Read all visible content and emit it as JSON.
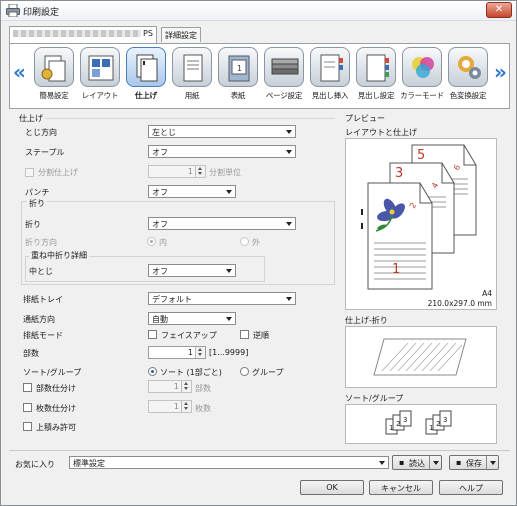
{
  "window": {
    "title": "印刷設定",
    "close_glyph": "✕"
  },
  "tabs": {
    "printer_tab_suffix": "PS",
    "detail_tab": "詳細設定"
  },
  "iconbar": {
    "prev_glyph": "«",
    "next_glyph": "»",
    "items": [
      {
        "label": "簡易設定",
        "icon": "quick-setup-icon"
      },
      {
        "label": "レイアウト",
        "icon": "layout-icon"
      },
      {
        "label": "仕上げ",
        "icon": "finishing-icon"
      },
      {
        "label": "用紙",
        "icon": "paper-icon"
      },
      {
        "label": "表紙",
        "icon": "cover-icon"
      },
      {
        "label": "ページ設定",
        "icon": "page-setup-icon"
      },
      {
        "label": "見出し挿入",
        "icon": "tab-insert-icon"
      },
      {
        "label": "見出し設定",
        "icon": "tab-setting-icon"
      },
      {
        "label": "カラーモード",
        "icon": "color-mode-icon"
      },
      {
        "label": "色変換設定",
        "icon": "color-conversion-icon"
      }
    ],
    "active": "仕上げ"
  },
  "finishing": {
    "section_title": "仕上げ",
    "binding_label": "とじ方向",
    "binding_value": "左とじ",
    "staple_label": "ステープル",
    "staple_value": "オフ",
    "split_finish_label": "分割仕上げ",
    "split_value": "1",
    "split_unit": "分割単位",
    "punch_label": "パンチ",
    "punch_value": "オフ",
    "fold_group_title": "折り",
    "fold_label": "折り",
    "fold_value": "オフ",
    "fold_dir_label": "折り方向",
    "fold_dir_in": "内",
    "fold_dir_out": "外",
    "saddle_group_title": "重ね中折り詳細",
    "saddle_label": "中とじ",
    "saddle_value": "オフ"
  },
  "output": {
    "tray_label": "排紙トレイ",
    "tray_value": "デフォルト",
    "feed_dir_label": "通紙方向",
    "feed_dir_value": "自動",
    "eject_mode_label": "排紙モード",
    "face_up_label": "フェイスアップ",
    "reverse_label": "逆順",
    "copies_label": "部数",
    "copies_value": "1",
    "copies_range": "[1...9999]",
    "sort_group_label": "ソート/グループ",
    "sort_label": "ソート (1部ごと)",
    "group_label": "グループ",
    "set_split_label": "部数仕分け",
    "set_split_value": "1",
    "set_split_unit": "部数",
    "sheet_split_label": "枚数仕分け",
    "sheet_split_value": "1",
    "sheet_split_unit": "枚数",
    "stack_label": "上積み許可"
  },
  "preview": {
    "title": "プレビュー",
    "layout_title": "レイアウトと仕上げ",
    "paper_size": "A4",
    "paper_dims": "210.0x297.0 mm",
    "page_numbers": [
      "5",
      "6",
      "3",
      "4",
      "1",
      "2"
    ],
    "fold_title": "仕上げ-折り",
    "sort_title": "ソート/グループ",
    "sort_digits": [
      "1",
      "2",
      "3",
      "1",
      "2",
      "3"
    ]
  },
  "bottom": {
    "favorites_label": "お気に入り",
    "favorites_value": "標準設定",
    "load_label": "読込",
    "save_label": "保存",
    "ok_label": "OK",
    "cancel_label": "キャンセル",
    "help_label": "ヘルプ"
  },
  "colors": {
    "accent": "#2d78c8",
    "page_number": "#c0392b",
    "flower": "#4a56a8"
  }
}
